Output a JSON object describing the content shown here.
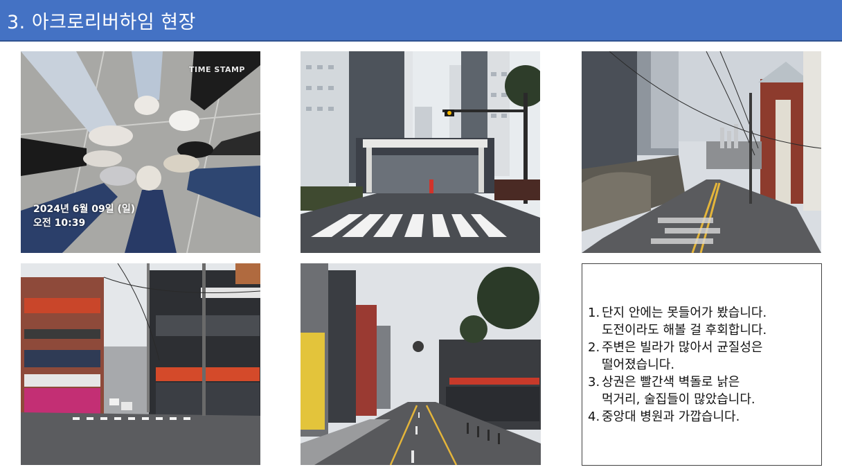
{
  "title": "3. 아크로리버하임 현장",
  "colors": {
    "title_bar": "#4472c4",
    "title_text": "#ffffff"
  },
  "photos": [
    {
      "name": "shoes-circle-photo",
      "overlay_logo": "TIME STAMP",
      "overlay_date": "2024년 6월 09일 (일)",
      "overlay_time": "오전 10:39"
    },
    {
      "name": "complex-gate-photo"
    },
    {
      "name": "hill-street-photo"
    },
    {
      "name": "intersection-shops-photo"
    },
    {
      "name": "downhill-street-photo"
    }
  ],
  "notes": [
    {
      "num": "1.",
      "lines": [
        "단지 안에는 못들어가 봤습니다.",
        "도전이라도 해볼 걸 후회합니다."
      ]
    },
    {
      "num": "2.",
      "lines": [
        "주변은 빌라가 많아서 균질성은",
        "떨어졌습니다."
      ]
    },
    {
      "num": "3.",
      "lines": [
        "상권은 빨간색 벽돌로 낡은",
        "먹거리, 술집들이 많았습니다."
      ]
    },
    {
      "num": "4.",
      "lines": [
        "중앙대 병원과 가깝습니다."
      ]
    }
  ]
}
